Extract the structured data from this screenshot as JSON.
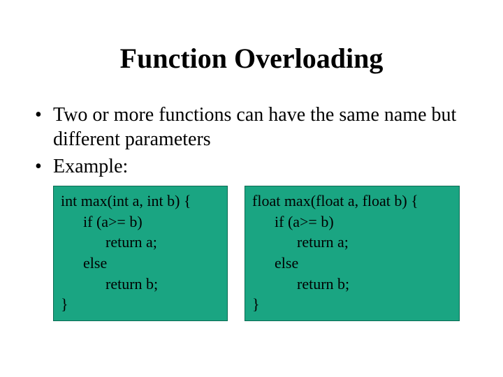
{
  "title": "Function Overloading",
  "bullets": [
    "Two or more functions can have the same name but different parameters",
    "Example:"
  ],
  "code_left": {
    "l1": "int max(int a, int b) {",
    "l2": "if (a>= b)",
    "l3": "return a;",
    "l4": "else",
    "l5": "return b;",
    "l6": "}"
  },
  "code_right": {
    "l1": "float max(float a, float b) {",
    "l2": "if (a>= b)",
    "l3": "return a;",
    "l4": "else",
    "l5": "return b;",
    "l6": "}"
  }
}
